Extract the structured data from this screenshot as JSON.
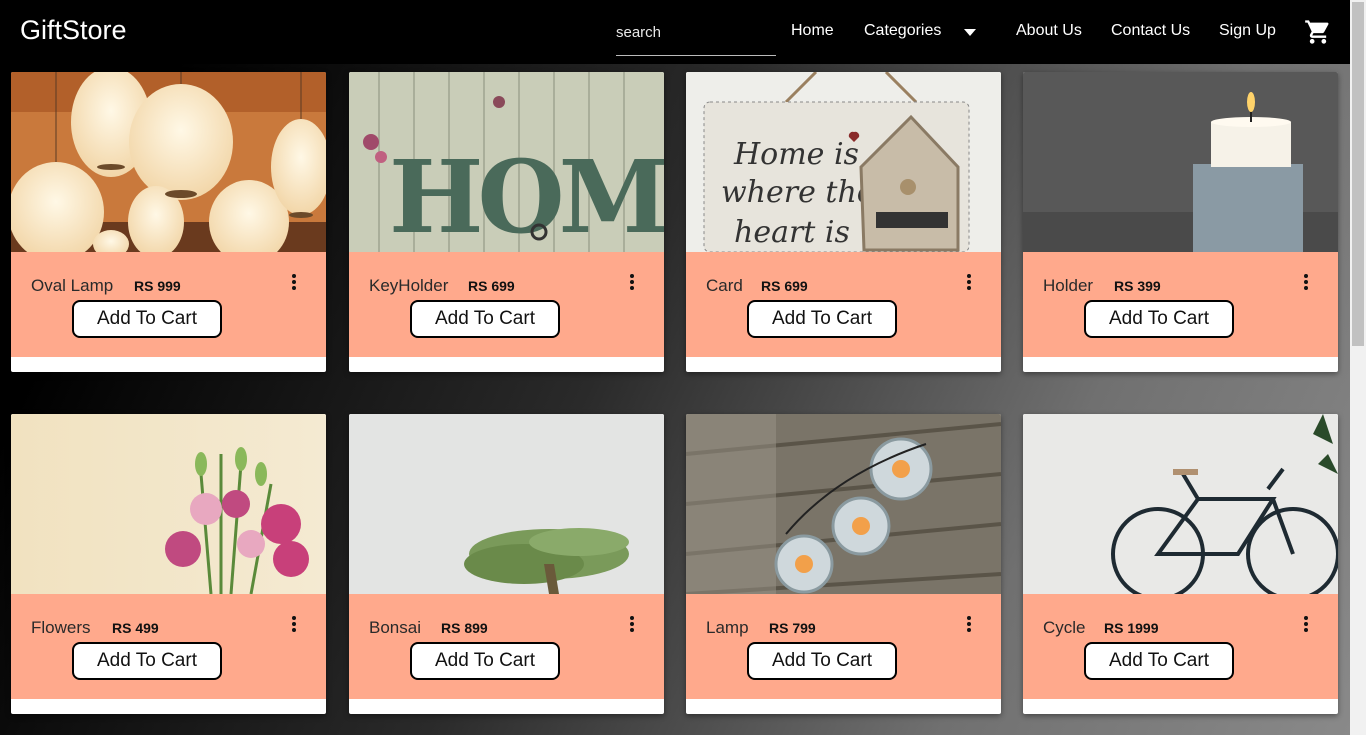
{
  "brand": "GiftStore",
  "search": {
    "placeholder": "search"
  },
  "nav": {
    "home": "Home",
    "categories": "Categories",
    "about": "About Us",
    "contact": "Contact Us",
    "signup": "Sign Up",
    "cart_icon": "shopping-cart-icon"
  },
  "colors": {
    "navbar": "#000000",
    "card_info": "#ffa98c",
    "button_bg": "#ffffff"
  },
  "products": [
    {
      "name": "Oval Lamp",
      "price": "RS 999",
      "button": "Add To Cart"
    },
    {
      "name": "KeyHolder",
      "price": "RS 699",
      "button": "Add To Cart"
    },
    {
      "name": "Card",
      "price": "RS 699",
      "button": "Add To Cart"
    },
    {
      "name": "Holder",
      "price": "RS 399",
      "button": "Add To Cart"
    },
    {
      "name": "Flowers",
      "price": "RS 499",
      "button": "Add To Cart"
    },
    {
      "name": "Bonsai",
      "price": "RS 899",
      "button": "Add To Cart"
    },
    {
      "name": "Lamp",
      "price": "RS 799",
      "button": "Add To Cart"
    },
    {
      "name": "Cycle",
      "price": "RS 1999",
      "button": "Add To Cart"
    }
  ],
  "image_text": {
    "home_sign": "HOME",
    "card_lines": [
      "Home is",
      "where the",
      "heart is"
    ]
  }
}
